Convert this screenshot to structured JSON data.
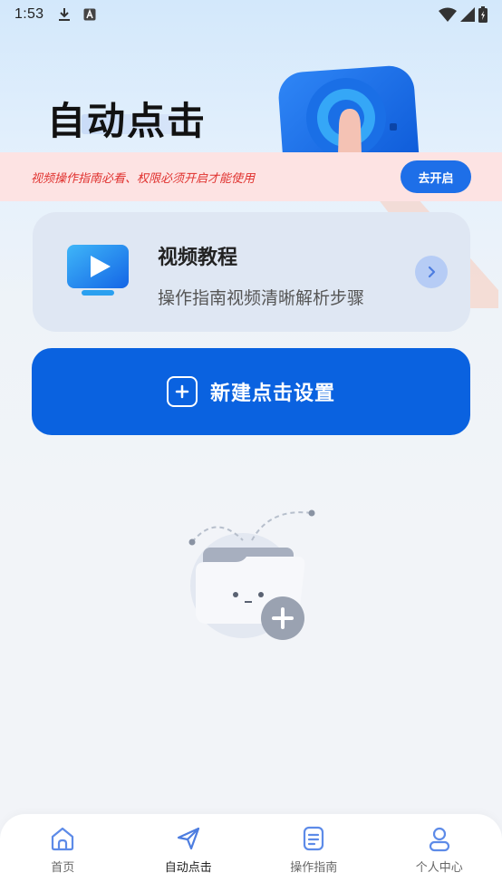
{
  "status_bar": {
    "time": "1:53",
    "left_icons": [
      "download-icon",
      "keyboard-a-icon"
    ],
    "right_icons": [
      "wifi-icon",
      "signal-icon",
      "battery-icon"
    ]
  },
  "hero": {
    "title": "自动点击"
  },
  "notice": {
    "text": "视频操作指南必看、权限必须开启才能使用",
    "button_label": "去开启",
    "text_color": "#e0312e",
    "background": "#fde3e3"
  },
  "video_card": {
    "title": "视频教程",
    "description": "操作指南视频清晰解析步骤"
  },
  "new_button": {
    "label": "新建点击设置",
    "color": "#0a62e0"
  },
  "bottom_nav": {
    "items": [
      {
        "label": "首页",
        "icon": "home-icon",
        "active": false
      },
      {
        "label": "自动点击",
        "icon": "send-icon",
        "active": true
      },
      {
        "label": "操作指南",
        "icon": "document-icon",
        "active": false
      },
      {
        "label": "个人中心",
        "icon": "user-icon",
        "active": false
      }
    ]
  },
  "colors": {
    "accent": "#0a62e0",
    "nav_icon": "#5d8be8"
  }
}
